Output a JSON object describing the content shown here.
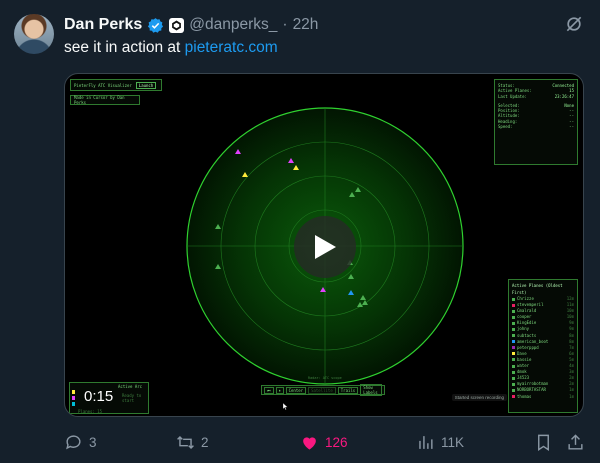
{
  "author": {
    "name": "Dan Perks",
    "handle": "@danperks_",
    "separator": "·",
    "time": "22h"
  },
  "tweet": {
    "text": "see it in action at ",
    "link": "pieteratc.com"
  },
  "app": {
    "title": "PieterFly ATC Visualizer",
    "launch_label": "Launch",
    "made_by": "Made in Cursor by Dan Perks",
    "status": [
      {
        "label": "Status:",
        "value": "Connected"
      },
      {
        "label": "Active Planes:",
        "value": "15"
      },
      {
        "label": "Last Update:",
        "value": "23:26:47"
      }
    ],
    "selected": [
      {
        "label": "Selected:",
        "value": "None"
      },
      {
        "label": "Position:",
        "value": "--"
      },
      {
        "label": "Altitude:",
        "value": "--"
      },
      {
        "label": "Heading:",
        "value": "--"
      },
      {
        "label": "Speed:",
        "value": "--"
      }
    ],
    "flights_title": "Active Planes (Oldest First)",
    "flights": [
      {
        "name": "Chrizze",
        "color": "#4caf50",
        "age": "12m"
      },
      {
        "name": "stevemperil",
        "color": "#e91e63",
        "age": "11m"
      },
      {
        "name": "Cmalrald",
        "color": "#4caf50",
        "age": "10m"
      },
      {
        "name": "cooper",
        "color": "#4caf50",
        "age": "10m"
      },
      {
        "name": "KingEdie",
        "color": "#4caf50",
        "age": "9m"
      },
      {
        "name": "johny",
        "color": "#4caf50",
        "age": "9m"
      },
      {
        "name": "subtacts",
        "color": "#4caf50",
        "age": "8m"
      },
      {
        "name": "american_boot",
        "color": "#2196f3",
        "age": "8m"
      },
      {
        "name": "peterpppd",
        "color": "#9c27b0",
        "age": "7m"
      },
      {
        "name": "Dave",
        "color": "#ffeb3b",
        "age": "6m"
      },
      {
        "name": "bassie",
        "color": "#4caf50",
        "age": "5m"
      },
      {
        "name": "water",
        "color": "#4caf50",
        "age": "4m"
      },
      {
        "name": "dmok",
        "color": "#4caf50",
        "age": "3m"
      },
      {
        "name": "J4523",
        "color": "#4caf50",
        "age": "2m"
      },
      {
        "name": "myairrobotman",
        "color": "#4caf50",
        "age": "2m"
      },
      {
        "name": "NORBORTASTAR",
        "color": "#4caf50",
        "age": "1m"
      },
      {
        "name": "thomas",
        "color": "#e91e63",
        "age": "1m"
      }
    ],
    "timer": "0:15",
    "timer_label": "Active Arc",
    "timer_note": "Ready to start",
    "timer_foot": "Planes: 15",
    "controls": [
      "⏮",
      "⏸",
      "Center",
      "Satellite",
      "Trails",
      "Show Labels"
    ],
    "radar_label": "Radar: ATC scope",
    "recording_toast": "Started screen recording"
  },
  "engagement": {
    "replies": "3",
    "retweets": "2",
    "likes": "126",
    "views": "11K"
  },
  "colors": {
    "accent": "#1d9bf0",
    "like": "#f91880",
    "radar": "#2fd12f"
  }
}
